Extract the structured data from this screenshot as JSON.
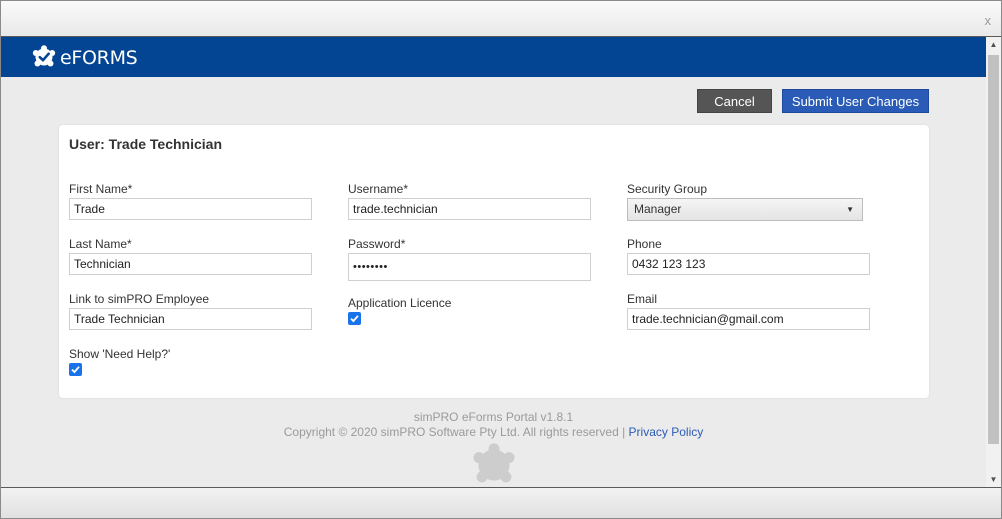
{
  "window": {
    "close_glyph": "x"
  },
  "header": {
    "brand": "eFORMS",
    "logo_icon": "eforms-gear-check-icon",
    "bg_color": "#034593"
  },
  "actions": {
    "cancel_label": "Cancel",
    "submit_label": "Submit User Changes"
  },
  "form": {
    "title": "User: Trade Technician",
    "first_name": {
      "label": "First Name*",
      "value": "Trade"
    },
    "last_name": {
      "label": "Last Name*",
      "value": "Technician"
    },
    "employee_link": {
      "label": "Link to simPRO Employee",
      "value": "Trade Technician"
    },
    "need_help": {
      "label": "Show 'Need Help?'",
      "checked": true
    },
    "username": {
      "label": "Username*",
      "value": "trade.technician"
    },
    "password": {
      "label": "Password*",
      "value": "••••••••"
    },
    "app_licence": {
      "label": "Application Licence",
      "checked": true
    },
    "security_group": {
      "label": "Security Group",
      "value": "Manager"
    },
    "phone": {
      "label": "Phone",
      "value": "0432 123 123"
    },
    "email": {
      "label": "Email",
      "value": "trade.technician@gmail.com"
    }
  },
  "footer": {
    "version": "simPRO eForms Portal v1.8.1",
    "copyright": "Copyright © 2020 simPRO Software Pty Ltd. All rights reserved |",
    "privacy_link": "Privacy Policy"
  }
}
